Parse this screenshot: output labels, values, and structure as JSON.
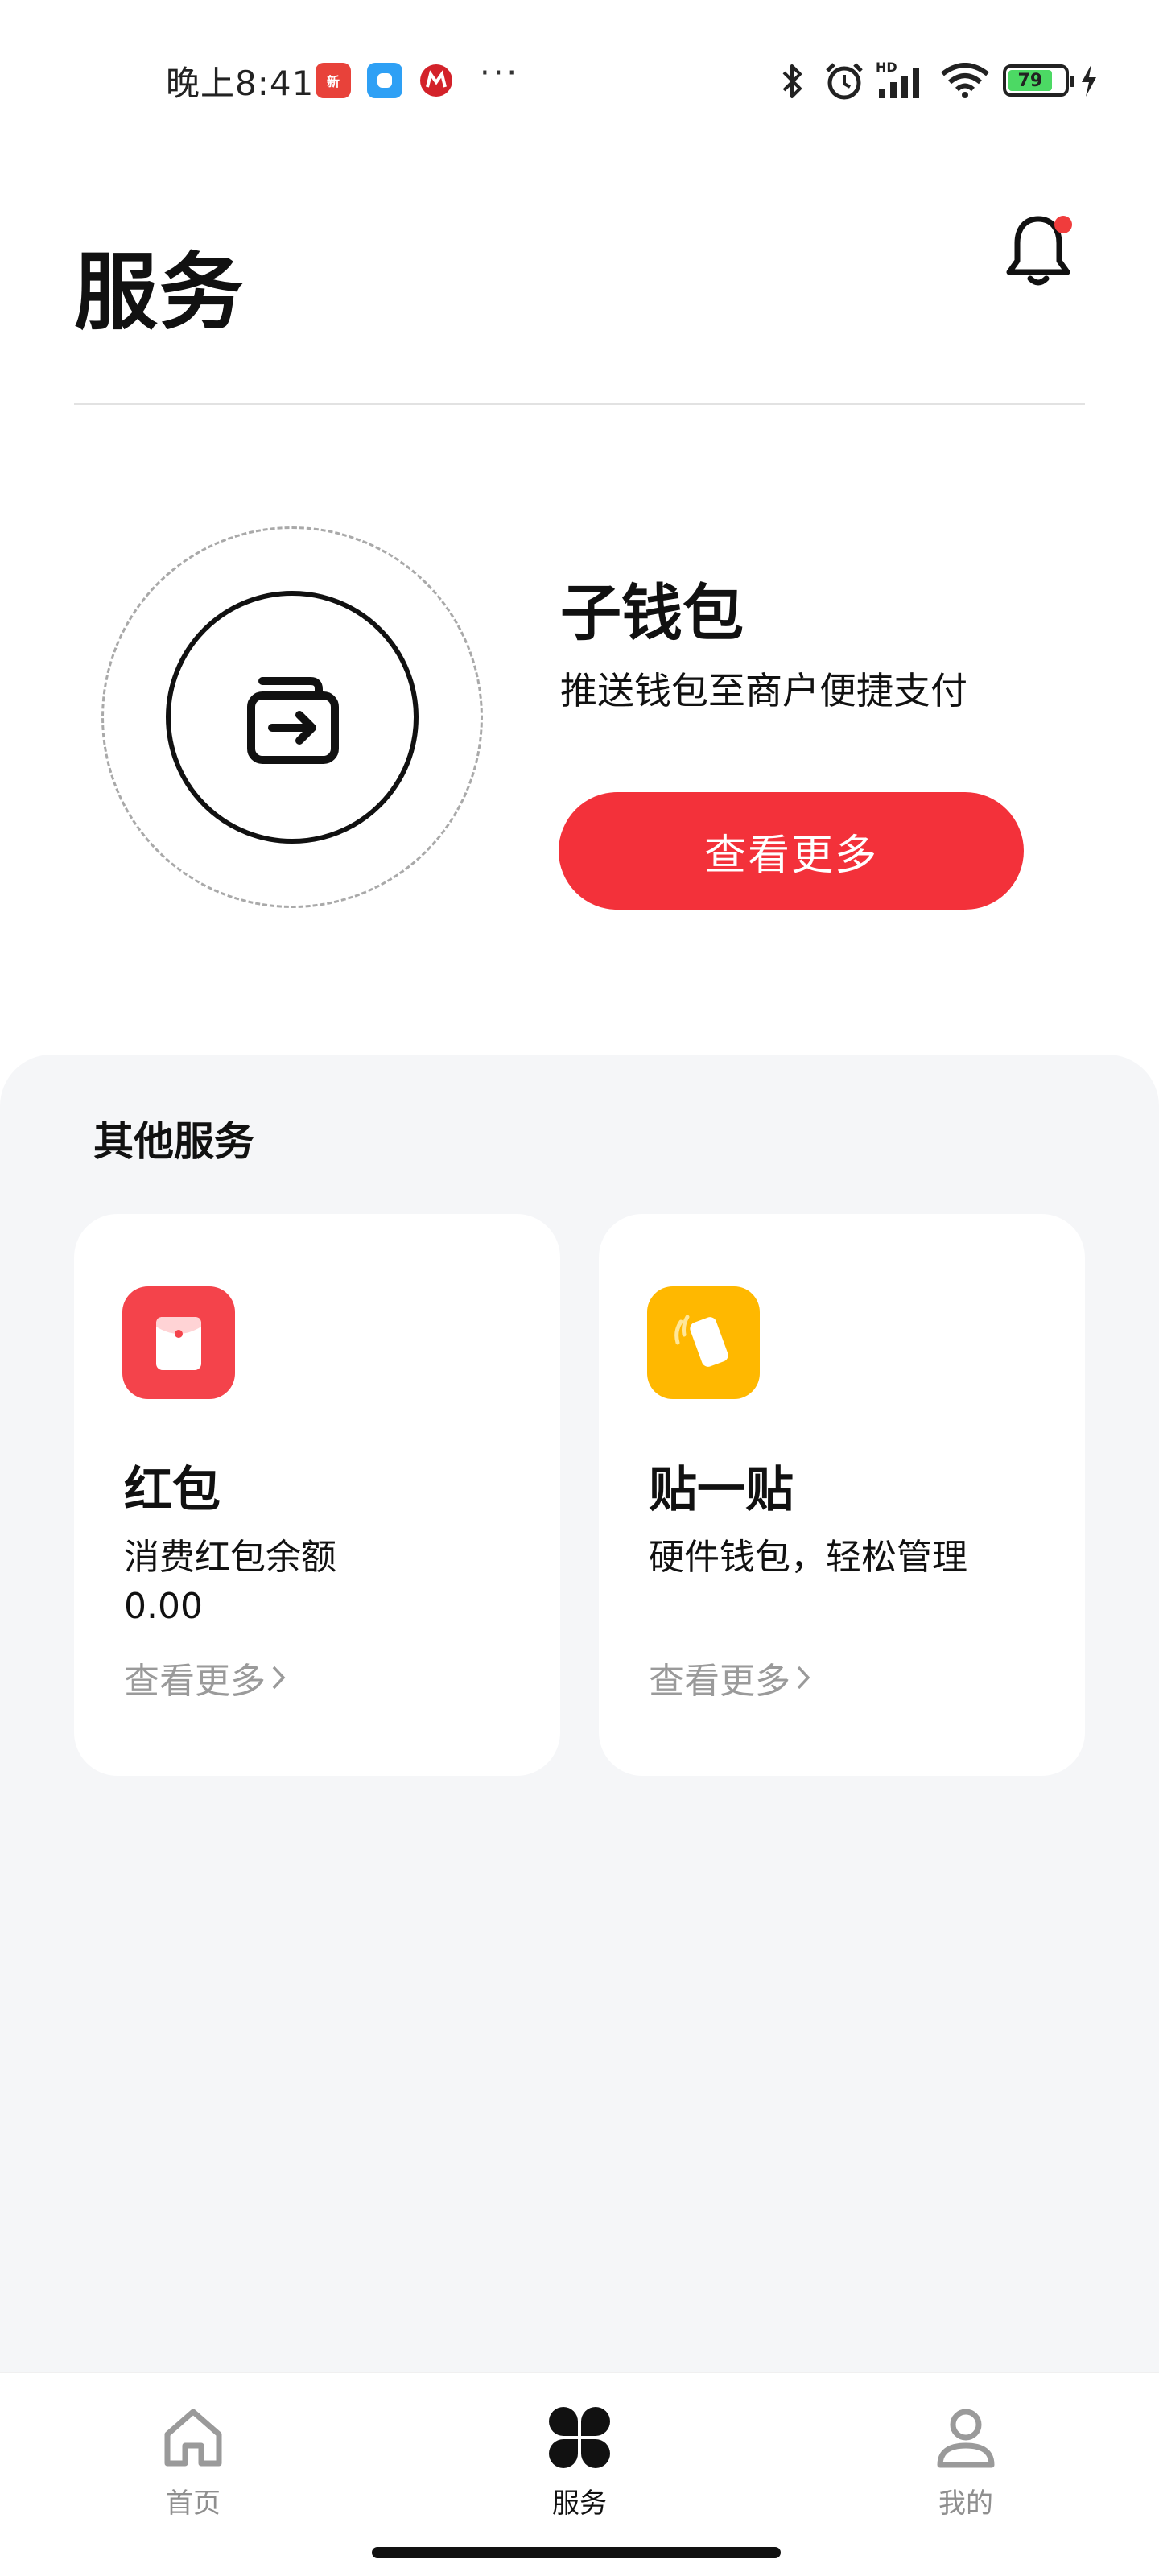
{
  "status_bar": {
    "time": "晚上8:41",
    "notification_icons": [
      "news-app-icon",
      "chat-app-icon",
      "bank-app-icon"
    ],
    "overflow": "···",
    "system_icons": [
      "bluetooth-icon",
      "alarm-icon",
      "hd-signal-icon",
      "wifi-icon",
      "battery-icon",
      "charging-icon"
    ],
    "signal_label": "HD",
    "battery_level": "79"
  },
  "header": {
    "title": "服务",
    "notification_badge": true
  },
  "sub_wallet": {
    "title": "子钱包",
    "subtitle": "推送钱包至商户便捷支付",
    "button_label": "查看更多",
    "icon": "wallet-export-icon"
  },
  "other_services": {
    "title": "其他服务",
    "cards": [
      {
        "title": "红包",
        "description": "消费红包余额",
        "value": "0.00",
        "link": "查看更多",
        "icon": "red-envelope-icon",
        "icon_color": "#f4434b"
      },
      {
        "title": "贴一贴",
        "description": "硬件钱包，轻松管理",
        "link": "查看更多",
        "icon": "tap-phone-icon",
        "icon_color": "#ffb800"
      }
    ]
  },
  "bottom_nav": {
    "items": [
      {
        "label": "首页",
        "icon": "home-icon",
        "active": false
      },
      {
        "label": "服务",
        "icon": "services-grid-icon",
        "active": true
      },
      {
        "label": "我的",
        "icon": "profile-icon",
        "active": false
      }
    ]
  },
  "colors": {
    "accent": "#f3313a",
    "panel_background": "#f5f6f8",
    "inactive_text": "#8f8f8f"
  }
}
